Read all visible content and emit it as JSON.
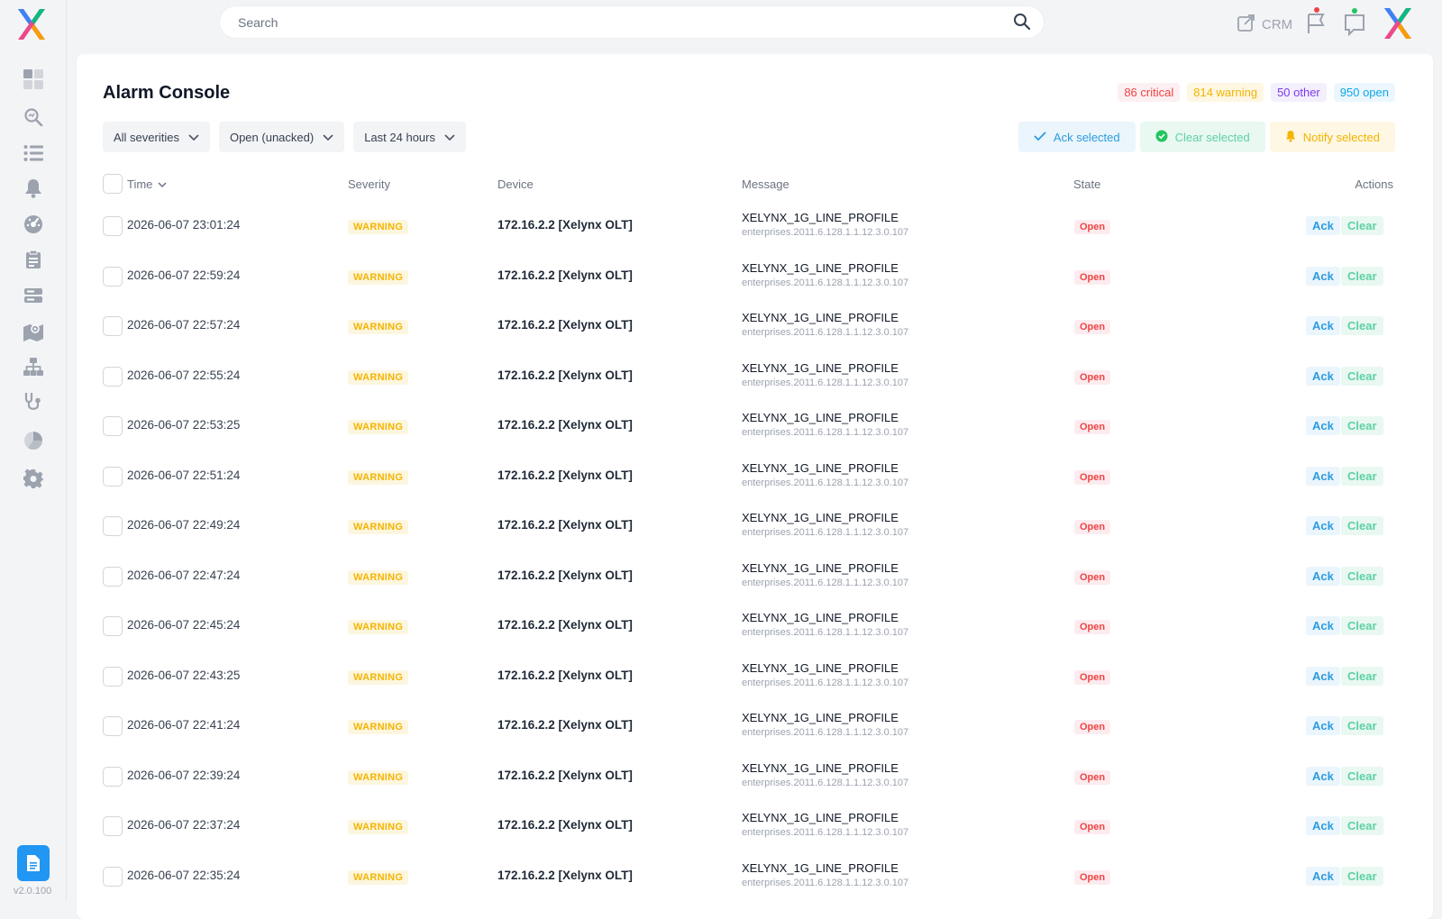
{
  "app": {
    "version": "v2.0.100"
  },
  "search": {
    "placeholder": "Search"
  },
  "topbar": {
    "crm_label": "CRM"
  },
  "page": {
    "title": "Alarm Console"
  },
  "summary": {
    "critical": "86 critical",
    "warning": "814 warning",
    "other": "50 other",
    "open": "950 open"
  },
  "filters": {
    "severity": "All severities",
    "state": "Open (unacked)",
    "range": "Last 24 hours"
  },
  "bulk_actions": {
    "ack": "Ack selected",
    "clear": "Clear selected",
    "notify": "Notify selected"
  },
  "columns": {
    "time": "Time",
    "severity": "Severity",
    "device": "Device",
    "message": "Message",
    "state": "State",
    "actions": "Actions"
  },
  "rows": [
    {
      "time": "2026-06-07 23:01:24",
      "severity": "WARNING",
      "device": "172.16.2.2 [Xelynx OLT]",
      "message": "XELYNX_1G_LINE_PROFILE",
      "oid": "enterprises.2011.6.128.1.1.12.3.0.107",
      "state": "Open",
      "ack": "Ack",
      "clear": "Clear"
    },
    {
      "time": "2026-06-07 22:59:24",
      "severity": "WARNING",
      "device": "172.16.2.2 [Xelynx OLT]",
      "message": "XELYNX_1G_LINE_PROFILE",
      "oid": "enterprises.2011.6.128.1.1.12.3.0.107",
      "state": "Open",
      "ack": "Ack",
      "clear": "Clear"
    },
    {
      "time": "2026-06-07 22:57:24",
      "severity": "WARNING",
      "device": "172.16.2.2 [Xelynx OLT]",
      "message": "XELYNX_1G_LINE_PROFILE",
      "oid": "enterprises.2011.6.128.1.1.12.3.0.107",
      "state": "Open",
      "ack": "Ack",
      "clear": "Clear"
    },
    {
      "time": "2026-06-07 22:55:24",
      "severity": "WARNING",
      "device": "172.16.2.2 [Xelynx OLT]",
      "message": "XELYNX_1G_LINE_PROFILE",
      "oid": "enterprises.2011.6.128.1.1.12.3.0.107",
      "state": "Open",
      "ack": "Ack",
      "clear": "Clear"
    },
    {
      "time": "2026-06-07 22:53:25",
      "severity": "WARNING",
      "device": "172.16.2.2 [Xelynx OLT]",
      "message": "XELYNX_1G_LINE_PROFILE",
      "oid": "enterprises.2011.6.128.1.1.12.3.0.107",
      "state": "Open",
      "ack": "Ack",
      "clear": "Clear"
    },
    {
      "time": "2026-06-07 22:51:24",
      "severity": "WARNING",
      "device": "172.16.2.2 [Xelynx OLT]",
      "message": "XELYNX_1G_LINE_PROFILE",
      "oid": "enterprises.2011.6.128.1.1.12.3.0.107",
      "state": "Open",
      "ack": "Ack",
      "clear": "Clear"
    },
    {
      "time": "2026-06-07 22:49:24",
      "severity": "WARNING",
      "device": "172.16.2.2 [Xelynx OLT]",
      "message": "XELYNX_1G_LINE_PROFILE",
      "oid": "enterprises.2011.6.128.1.1.12.3.0.107",
      "state": "Open",
      "ack": "Ack",
      "clear": "Clear"
    },
    {
      "time": "2026-06-07 22:47:24",
      "severity": "WARNING",
      "device": "172.16.2.2 [Xelynx OLT]",
      "message": "XELYNX_1G_LINE_PROFILE",
      "oid": "enterprises.2011.6.128.1.1.12.3.0.107",
      "state": "Open",
      "ack": "Ack",
      "clear": "Clear"
    },
    {
      "time": "2026-06-07 22:45:24",
      "severity": "WARNING",
      "device": "172.16.2.2 [Xelynx OLT]",
      "message": "XELYNX_1G_LINE_PROFILE",
      "oid": "enterprises.2011.6.128.1.1.12.3.0.107",
      "state": "Open",
      "ack": "Ack",
      "clear": "Clear"
    },
    {
      "time": "2026-06-07 22:43:25",
      "severity": "WARNING",
      "device": "172.16.2.2 [Xelynx OLT]",
      "message": "XELYNX_1G_LINE_PROFILE",
      "oid": "enterprises.2011.6.128.1.1.12.3.0.107",
      "state": "Open",
      "ack": "Ack",
      "clear": "Clear"
    },
    {
      "time": "2026-06-07 22:41:24",
      "severity": "WARNING",
      "device": "172.16.2.2 [Xelynx OLT]",
      "message": "XELYNX_1G_LINE_PROFILE",
      "oid": "enterprises.2011.6.128.1.1.12.3.0.107",
      "state": "Open",
      "ack": "Ack",
      "clear": "Clear"
    },
    {
      "time": "2026-06-07 22:39:24",
      "severity": "WARNING",
      "device": "172.16.2.2 [Xelynx OLT]",
      "message": "XELYNX_1G_LINE_PROFILE",
      "oid": "enterprises.2011.6.128.1.1.12.3.0.107",
      "state": "Open",
      "ack": "Ack",
      "clear": "Clear"
    },
    {
      "time": "2026-06-07 22:37:24",
      "severity": "WARNING",
      "device": "172.16.2.2 [Xelynx OLT]",
      "message": "XELYNX_1G_LINE_PROFILE",
      "oid": "enterprises.2011.6.128.1.1.12.3.0.107",
      "state": "Open",
      "ack": "Ack",
      "clear": "Clear"
    },
    {
      "time": "2026-06-07 22:35:24",
      "severity": "WARNING",
      "device": "172.16.2.2 [Xelynx OLT]",
      "message": "XELYNX_1G_LINE_PROFILE",
      "oid": "enterprises.2011.6.128.1.1.12.3.0.107",
      "state": "Open",
      "ack": "Ack",
      "clear": "Clear"
    }
  ],
  "colors": {
    "accent_blue": "#2196f3",
    "critical": "#ef4444",
    "warning": "#f4b400",
    "other": "#7c3aed",
    "open": "#0ea5e9",
    "clear": "#22c55e"
  },
  "sidebar": {
    "icons": [
      "dashboard-icon",
      "search-analytics-icon",
      "list-icon",
      "bell-icon",
      "gauge-icon",
      "clipboard-icon",
      "server-icon",
      "map-icon",
      "network-icon",
      "stethoscope-icon",
      "pie-chart-icon",
      "gear-icon"
    ]
  }
}
